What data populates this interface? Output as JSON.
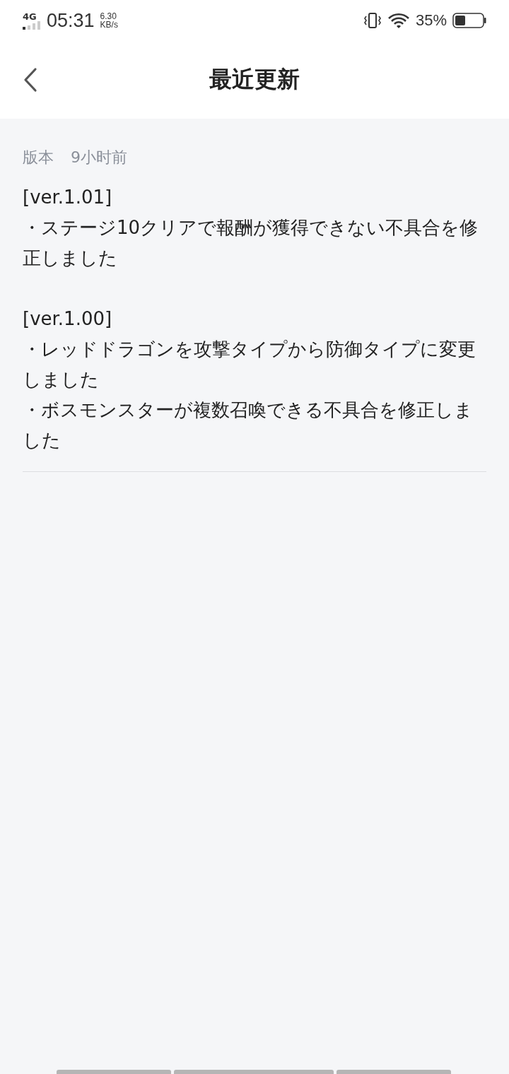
{
  "status_bar": {
    "network": "4G",
    "time": "05:31",
    "speed": "6.30",
    "speed_unit": "KB/s",
    "battery": "35%"
  },
  "header": {
    "title": "最近更新"
  },
  "meta": {
    "label": "版本",
    "time": "9小时前"
  },
  "releases": [
    {
      "version": "[ver.1.01]",
      "items": [
        "・ステージ10クリアで報酬が獲得できない不具合を修正しました"
      ]
    },
    {
      "version": "[ver.1.00]",
      "items": [
        "・レッドドラゴンを攻撃タイプから防御タイプに変更しました",
        "・ボスモンスターが複数召喚できる不具合を修正しました"
      ]
    }
  ]
}
